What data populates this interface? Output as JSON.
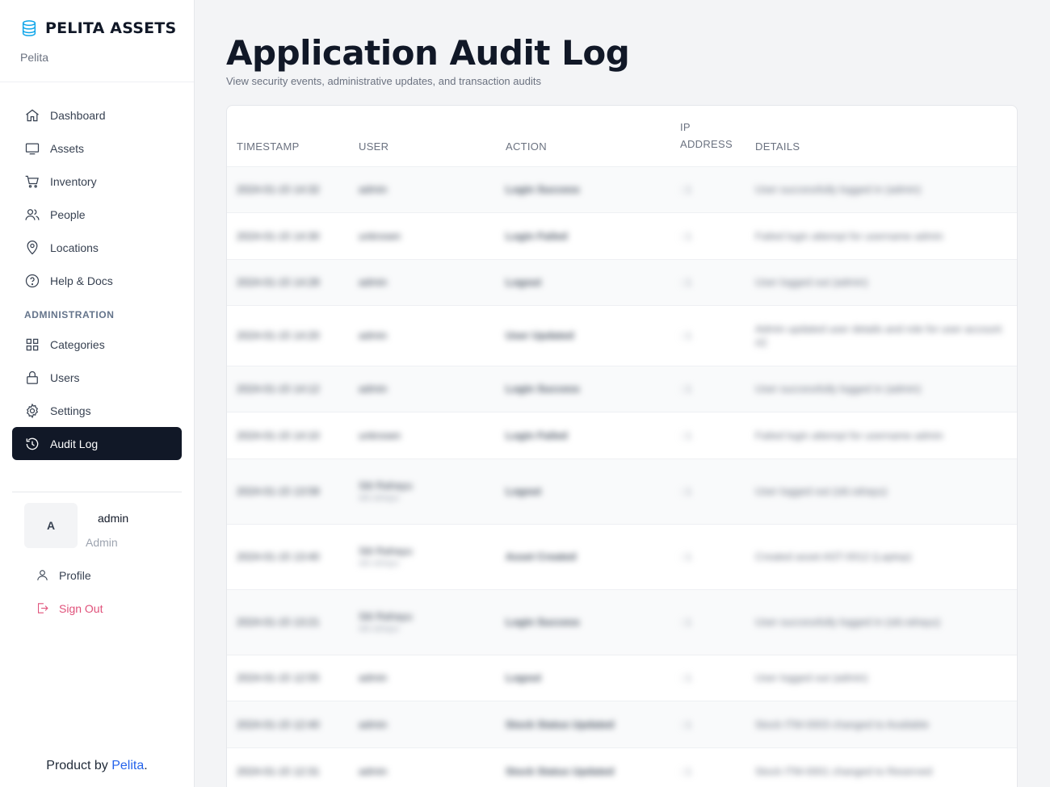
{
  "brand": {
    "title": "PELITA ASSETS",
    "subtitle": "Pelita",
    "icon": "database-icon"
  },
  "nav": [
    {
      "label": "Dashboard",
      "icon": "home-icon"
    },
    {
      "label": "Assets",
      "icon": "monitor-icon"
    },
    {
      "label": "Inventory",
      "icon": "cart-icon"
    },
    {
      "label": "People",
      "icon": "users-icon"
    },
    {
      "label": "Locations",
      "icon": "map-pin-icon"
    },
    {
      "label": "Help & Docs",
      "icon": "help-circle-icon"
    }
  ],
  "admin_section": {
    "heading": "ADMINISTRATION",
    "items": [
      {
        "label": "Categories",
        "icon": "grid-icon"
      },
      {
        "label": "Users",
        "icon": "lock-icon"
      },
      {
        "label": "Settings",
        "icon": "gear-icon"
      },
      {
        "label": "Audit Log",
        "icon": "history-icon",
        "active": true
      }
    ]
  },
  "user": {
    "initial": "A",
    "name": "admin",
    "role": "Admin",
    "profile_label": "Profile",
    "signout_label": "Sign Out"
  },
  "footer": {
    "prefix": "Product by ",
    "link": "Pelita",
    "suffix": "."
  },
  "page": {
    "title": "Application Audit Log",
    "subtitle": "View security events, administrative updates, and transaction audits"
  },
  "table": {
    "headers": [
      "TIMESTAMP",
      "USER",
      "ACTION",
      "IP ADDRESS",
      "DETAILS"
    ],
    "rows": [
      {
        "timestamp": "2024-01-15 14:32",
        "user": "admin",
        "user_sub": "",
        "action": "Login Success",
        "ip": "::1",
        "details": "User successfully logged in (admin)"
      },
      {
        "timestamp": "2024-01-15 14:30",
        "user": "unknown",
        "user_sub": "",
        "action": "Login Failed",
        "ip": "::1",
        "details": "Failed login attempt for username admin"
      },
      {
        "timestamp": "2024-01-15 14:28",
        "user": "admin",
        "user_sub": "",
        "action": "Logout",
        "ip": "::1",
        "details": "User logged out (admin)"
      },
      {
        "timestamp": "2024-01-15 14:20",
        "user": "admin",
        "user_sub": "",
        "action": "User Updated",
        "ip": "::1",
        "details": "Admin updated user details and role for user account #2"
      },
      {
        "timestamp": "2024-01-15 14:12",
        "user": "admin",
        "user_sub": "",
        "action": "Login Success",
        "ip": "::1",
        "details": "User successfully logged in (admin)"
      },
      {
        "timestamp": "2024-01-15 14:10",
        "user": "unknown",
        "user_sub": "",
        "action": "Login Failed",
        "ip": "::1",
        "details": "Failed login attempt for username admin"
      },
      {
        "timestamp": "2024-01-15 13:58",
        "user": "Siti Rahayu",
        "user_sub": "siti.rahayu",
        "action": "Logout",
        "ip": "::1",
        "details": "User logged out (siti.rahayu)"
      },
      {
        "timestamp": "2024-01-15 13:40",
        "user": "Siti Rahayu",
        "user_sub": "siti.rahayu",
        "action": "Asset Created",
        "ip": "::1",
        "details": "Created asset AST-0012 (Laptop)"
      },
      {
        "timestamp": "2024-01-15 13:21",
        "user": "Siti Rahayu",
        "user_sub": "siti.rahayu",
        "action": "Login Success",
        "ip": "::1",
        "details": "User successfully logged in (siti.rahayu)"
      },
      {
        "timestamp": "2024-01-15 12:55",
        "user": "admin",
        "user_sub": "",
        "action": "Logout",
        "ip": "::1",
        "details": "User logged out (admin)"
      },
      {
        "timestamp": "2024-01-15 12:40",
        "user": "admin",
        "user_sub": "",
        "action": "Stock Status Updated",
        "ip": "::1",
        "details": "Stock ITM-0003 changed to Available"
      },
      {
        "timestamp": "2024-01-15 12:31",
        "user": "admin",
        "user_sub": "",
        "action": "Stock Status Updated",
        "ip": "::1",
        "details": "Stock ITM-0001 changed to Reserved"
      }
    ]
  }
}
